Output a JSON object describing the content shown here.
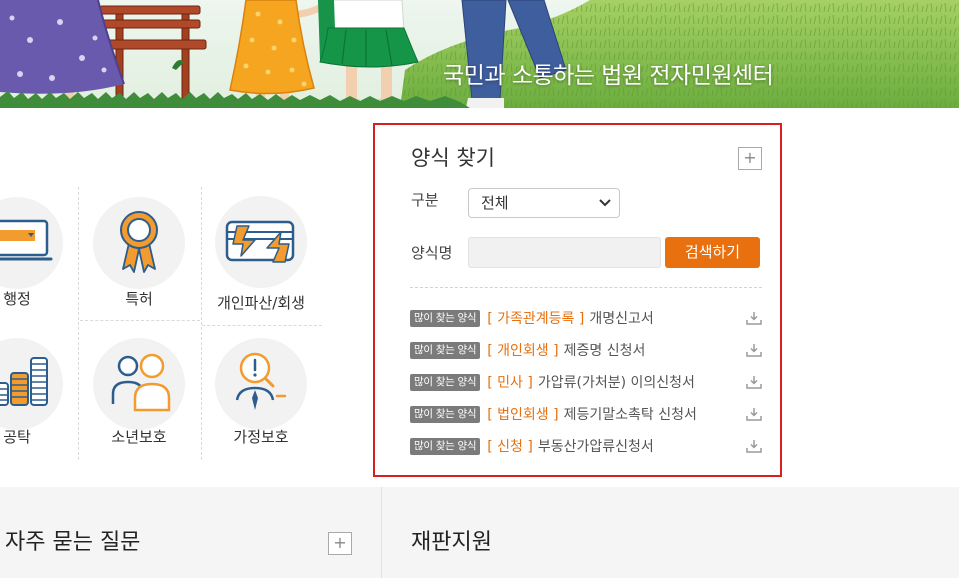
{
  "banner": {
    "slogan": "국민과 소통하는 법원 전자민원센터"
  },
  "categories": [
    {
      "label": "행정",
      "icon": "monitor-icon"
    },
    {
      "label": "특허",
      "icon": "award-medal-icon"
    },
    {
      "label": "개인파산/회생",
      "icon": "card-exchange-icon"
    },
    {
      "label": "공탁",
      "icon": "coin-stack-icon"
    },
    {
      "label": "소년보호",
      "icon": "two-people-icon"
    },
    {
      "label": "가정보호",
      "icon": "magnifier-person-icon"
    }
  ],
  "form_search": {
    "title": "양식 찾기",
    "more_button": "+",
    "division_label": "구분",
    "division_selected": "전체",
    "form_name_label": "양식명",
    "search_button": "검색하기",
    "popular_badge": "많이 찾는 양식",
    "item_icon": "download-icon",
    "items": [
      {
        "category": "[ 가족관계등록 ]",
        "title": "개명신고서"
      },
      {
        "category": "[ 개인회생 ]",
        "title": "제증명 신청서"
      },
      {
        "category": "[ 민사 ]",
        "title": "가압류(가처분) 이의신청서"
      },
      {
        "category": "[ 법인회생 ]",
        "title": "제등기말소촉탁 신청서"
      },
      {
        "category": "[ 신청 ]",
        "title": "부동산가압류신청서"
      }
    ]
  },
  "faq": {
    "title": "자주 묻는 질문",
    "more_button": "+"
  },
  "trial_support": {
    "title": "재판지원"
  },
  "colors": {
    "highlight_border": "#d71f1f",
    "accent_orange": "#e8700e",
    "badge_gray": "#7b7b7b",
    "icon_blue": "#2d5d8c"
  }
}
